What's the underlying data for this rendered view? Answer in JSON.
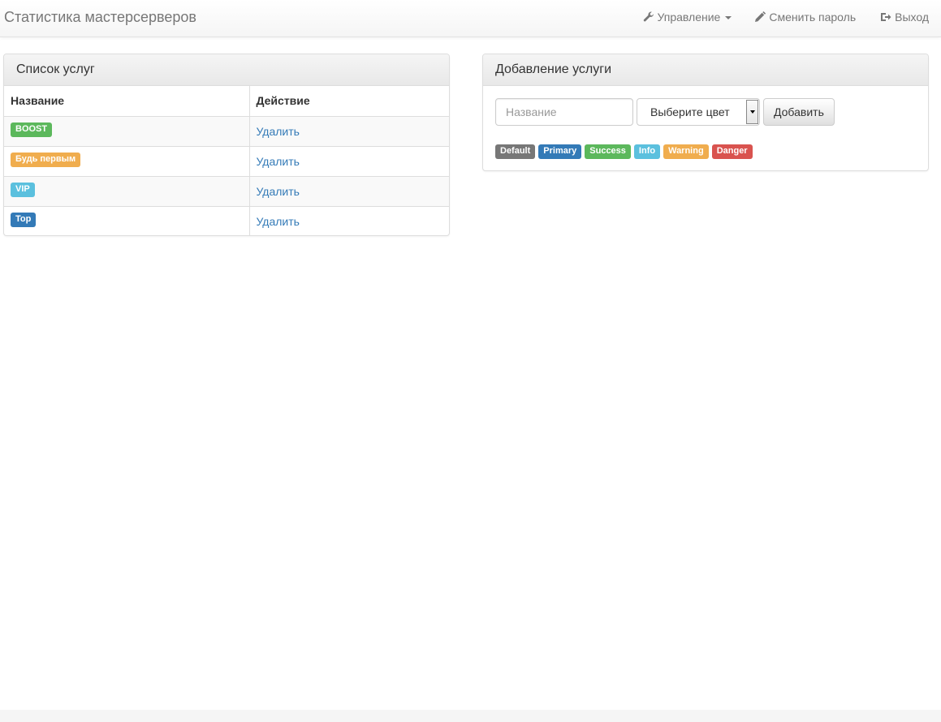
{
  "navbar": {
    "brand": "Статистика мастерсерверов",
    "manage_label": "Управление",
    "change_password_label": "Сменить пароль",
    "logout_label": "Выход"
  },
  "services_panel": {
    "title": "Список услуг",
    "col_name": "Название",
    "col_action": "Действие",
    "rows": [
      {
        "name": "BOOST",
        "color": "success",
        "action": "Удалить"
      },
      {
        "name": "Будь первым",
        "color": "warning",
        "action": "Удалить"
      },
      {
        "name": "VIP",
        "color": "info",
        "action": "Удалить"
      },
      {
        "name": "Top",
        "color": "primary",
        "action": "Удалить"
      }
    ]
  },
  "add_panel": {
    "title": "Добавление услуги",
    "name_placeholder": "Название",
    "color_select": "Выберите цвет",
    "add_button": "Добавить",
    "palette": [
      "Default",
      "Primary",
      "Success",
      "Info",
      "Warning",
      "Danger"
    ]
  },
  "colors": {
    "default": "#777777",
    "primary": "#337ab7",
    "success": "#5cb85c",
    "info": "#5bc0de",
    "warning": "#f0ad4e",
    "danger": "#d9534f"
  }
}
